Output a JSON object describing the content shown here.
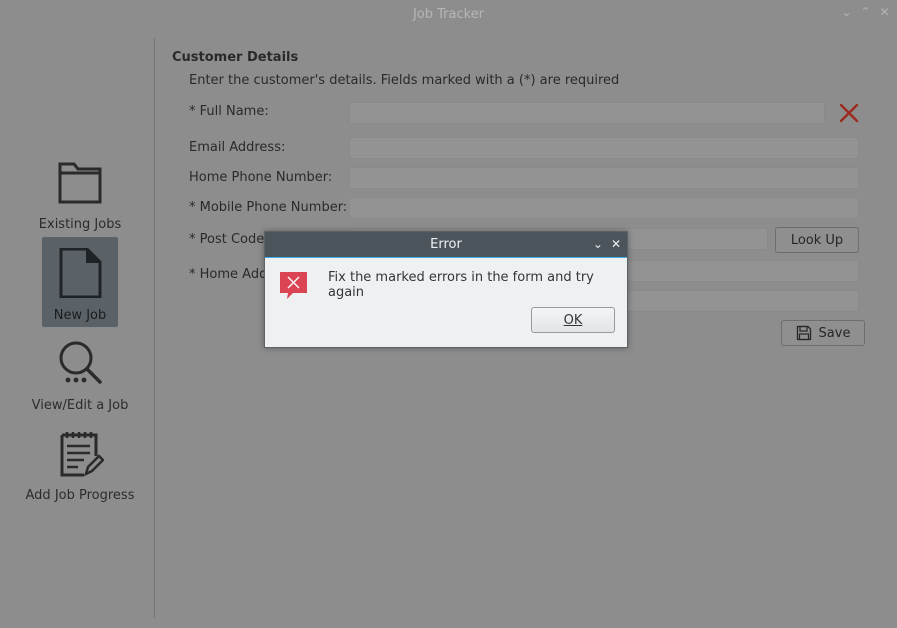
{
  "window": {
    "title": "Job Tracker",
    "controls": {
      "minimize": "⌄",
      "maximize": "⌃",
      "close": "✕"
    }
  },
  "sidebar": {
    "items": [
      {
        "label": "Existing Jobs",
        "icon": "folder-icon"
      },
      {
        "label": "New Job",
        "icon": "document-icon",
        "selected": true
      },
      {
        "label": "View/Edit a Job",
        "icon": "search-icon"
      },
      {
        "label": "Add Job Progress",
        "icon": "notepad-edit-icon"
      }
    ]
  },
  "form": {
    "title": "Customer Details",
    "instructions": "Enter the customer's details. Fields marked with a (*) are required",
    "fields": [
      {
        "label": "* Full Name:",
        "value": ""
      },
      {
        "label": "Email Address:",
        "value": ""
      },
      {
        "label": "Home Phone Number:",
        "value": ""
      },
      {
        "label": "* Mobile Phone Number:",
        "value": ""
      },
      {
        "label": "* Post Code:",
        "value": ""
      },
      {
        "label": "* Home Add",
        "value": ""
      }
    ],
    "lookup_label": "Look Up",
    "save_label": "Save"
  },
  "dialog": {
    "title": "Error",
    "message": "Fix the marked errors in the form and try again",
    "ok_label": "OK"
  },
  "colors": {
    "error": "#c0392b",
    "dialog_title_bg": "#4c555b",
    "focus": "#3daee9"
  }
}
